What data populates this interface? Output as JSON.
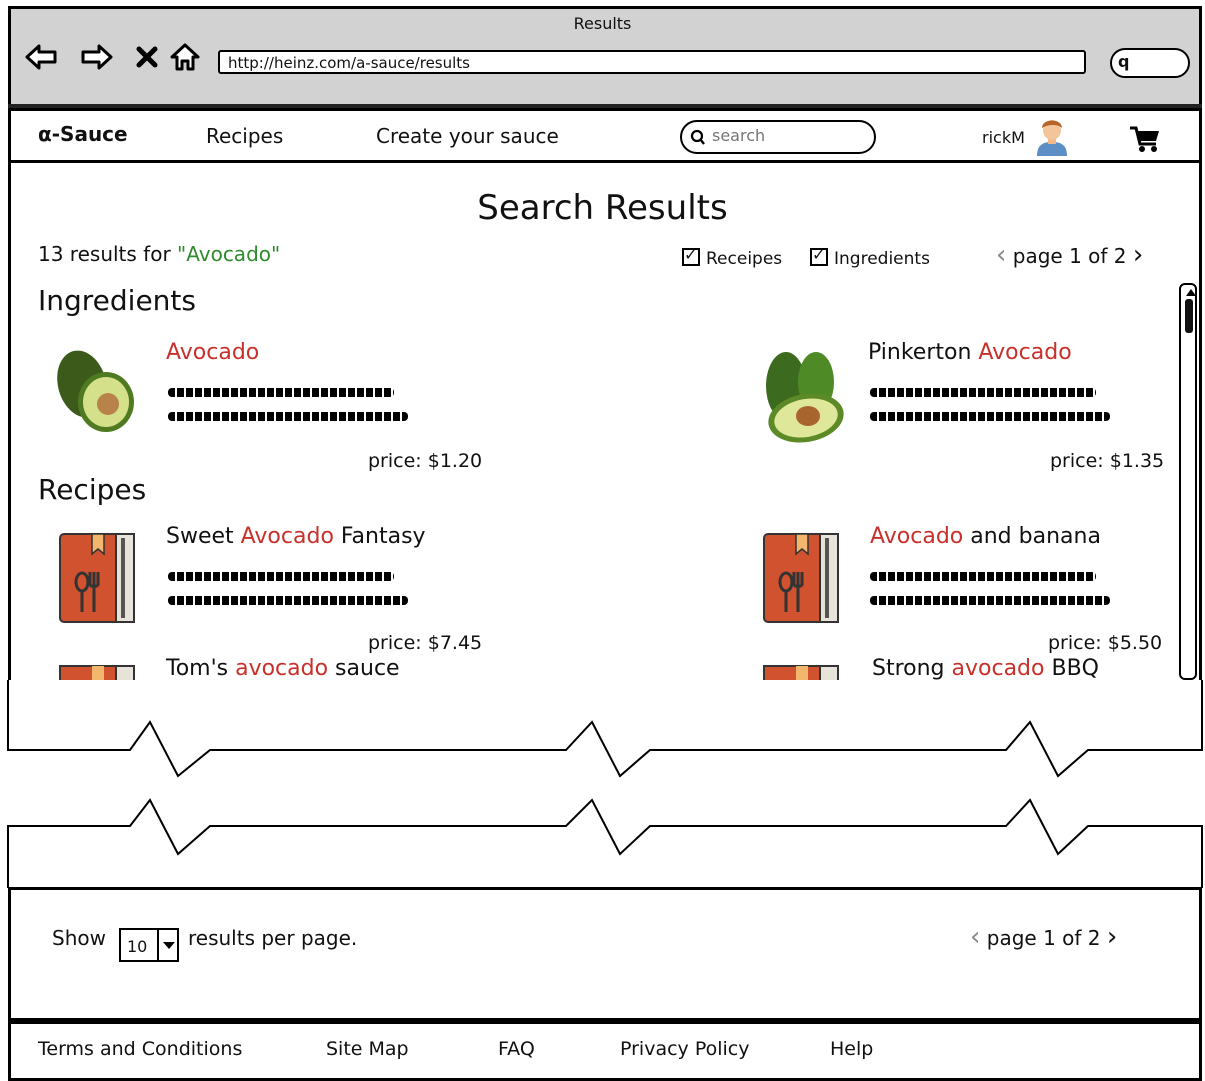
{
  "browser": {
    "window_title": "Results",
    "url": "http://heinz.com/a-sauce/results",
    "search_glyph": "q"
  },
  "header": {
    "logo": "α-Sauce",
    "nav": [
      "Recipes",
      "Create your sauce"
    ],
    "search_placeholder": "search",
    "user": "rickM"
  },
  "page": {
    "title": "Search Results",
    "summary_prefix": "13 results for",
    "query": "\"Avocado\"",
    "filters": [
      {
        "label": "Receipes",
        "checked": true
      },
      {
        "label": "Ingredients",
        "checked": true
      }
    ],
    "pager": {
      "label": "page 1 of 2",
      "prev": "‹",
      "next": "›"
    }
  },
  "ingredients": {
    "heading": "Ingredients",
    "items": [
      {
        "title_pre": "",
        "title_hl": "Avocado",
        "title_post": "",
        "price": "price: $1.20",
        "icon": "avocado-icon"
      },
      {
        "title_pre": "Pinkerton ",
        "title_hl": "Avocado",
        "title_post": "",
        "price": "price: $1.35",
        "icon": "avocado-icon"
      }
    ]
  },
  "recipes": {
    "heading": "Recipes",
    "items": [
      {
        "title_pre": "Sweet ",
        "title_hl": "Avocado",
        "title_post": " Fantasy",
        "price": "price: $7.45",
        "icon": "recipe-book-icon"
      },
      {
        "title_pre": "",
        "title_hl": "Avocado",
        "title_post": " and banana",
        "price": "price: $5.50",
        "icon": "recipe-book-icon"
      },
      {
        "title_pre": "Tom's ",
        "title_hl": "avocado",
        "title_post": " sauce",
        "icon": "recipe-book-icon"
      },
      {
        "title_pre": "Strong ",
        "title_hl": "avocado",
        "title_post": " BBQ",
        "icon": "recipe-book-icon"
      }
    ]
  },
  "pagination": {
    "show_label": "Show",
    "per_page_value": "10",
    "per_page_suffix": "results per page.",
    "pager_label": "page 1 of 2"
  },
  "footer": {
    "links": [
      "Terms and Conditions",
      "Site Map",
      "FAQ",
      "Privacy Policy",
      "Help"
    ]
  },
  "colors": {
    "highlight": "#c8302a",
    "query": "#2e8b2e",
    "chrome": "#d2d2d2"
  }
}
